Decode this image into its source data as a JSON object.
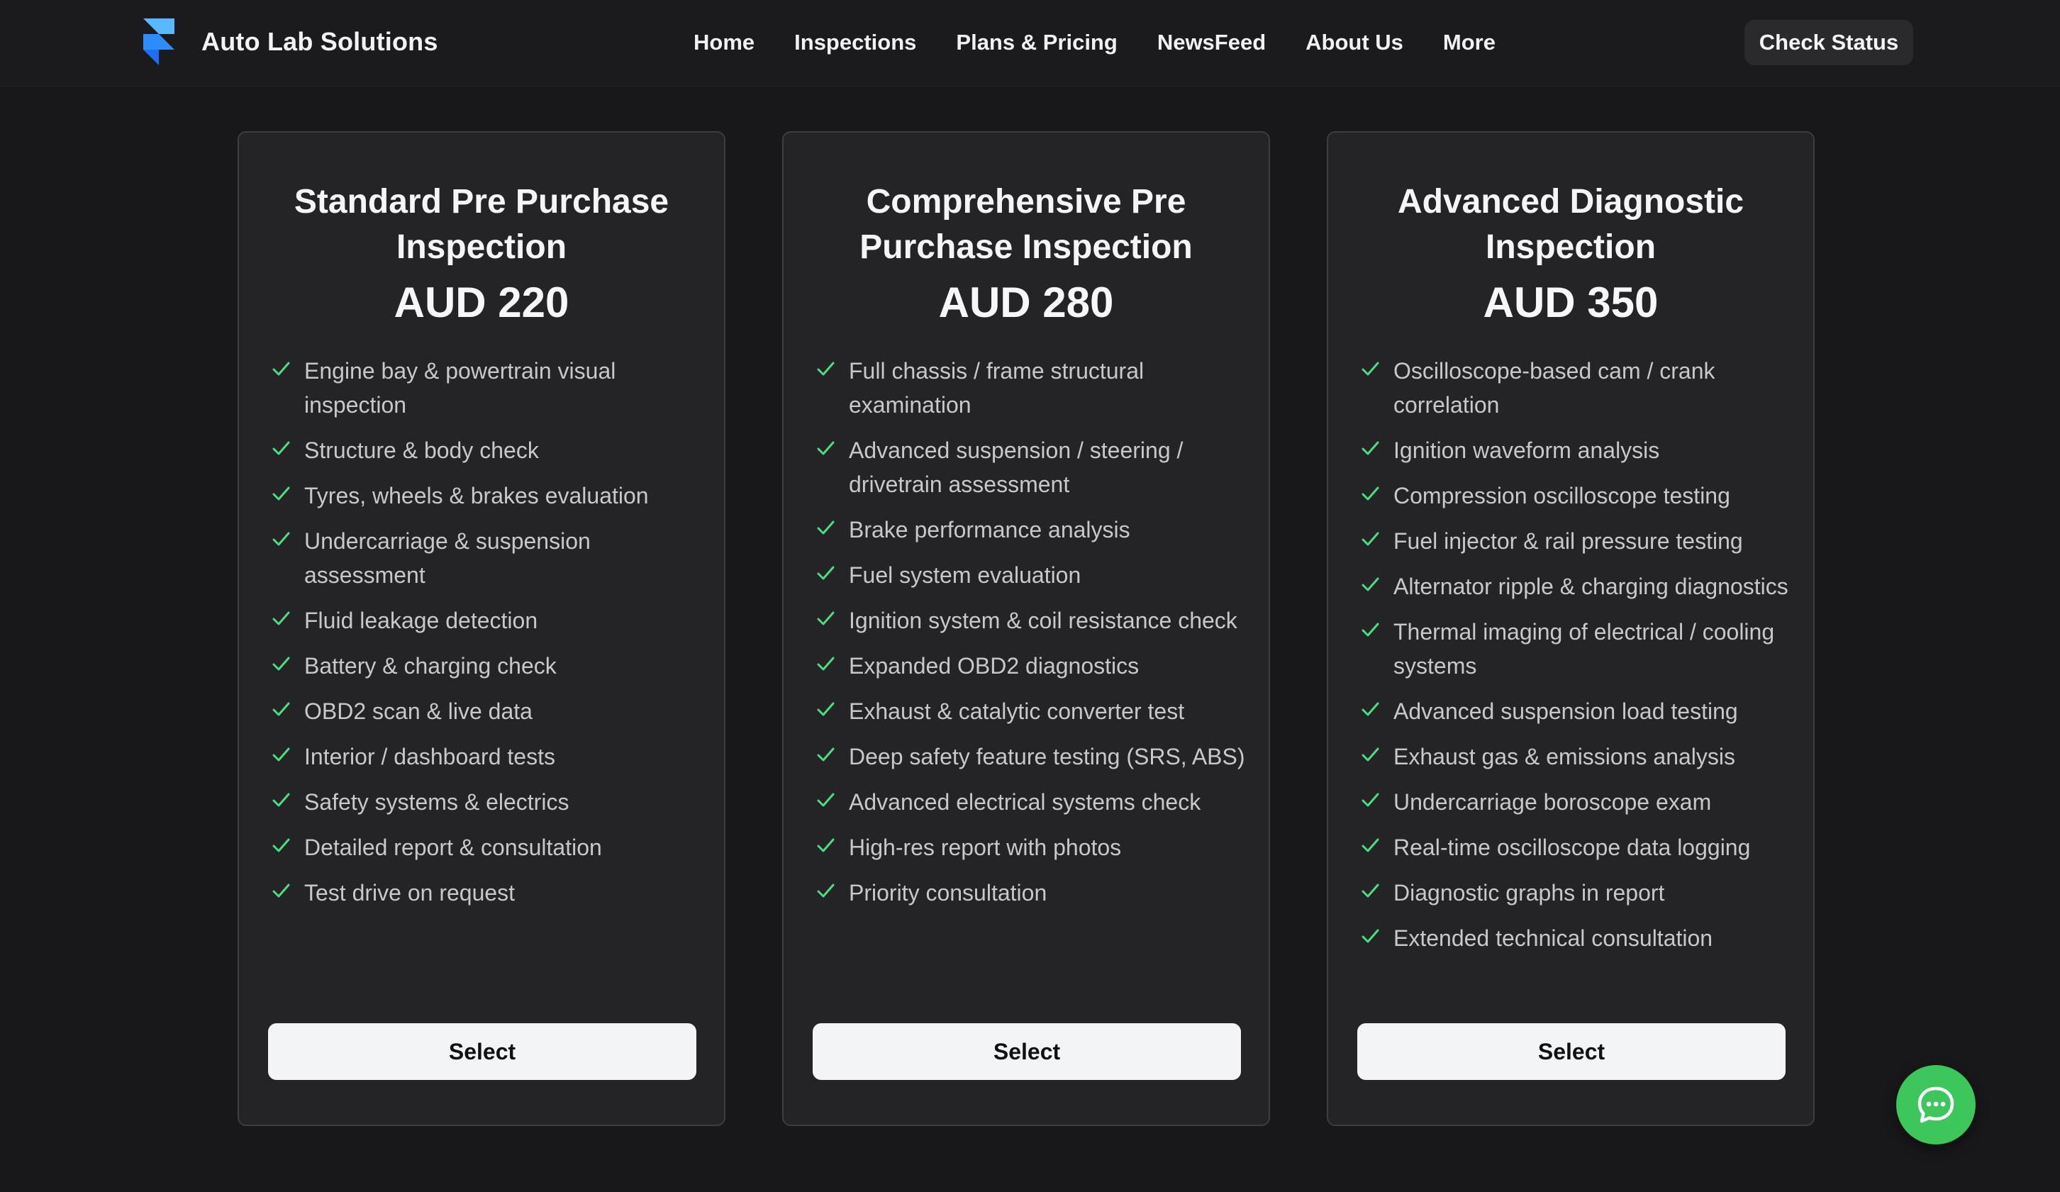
{
  "header": {
    "brand": "Auto Lab Solutions",
    "nav": [
      "Home",
      "Inspections",
      "Plans & Pricing",
      "NewsFeed",
      "About Us",
      "More"
    ],
    "check_status": "Check Status"
  },
  "plans": [
    {
      "title": "Standard Pre Purchase Inspection",
      "price": "AUD 220",
      "features": [
        "Engine bay & powertrain visual inspection",
        "Structure & body check",
        "Tyres, wheels & brakes evaluation",
        "Undercarriage & suspension assessment",
        "Fluid leakage detection",
        "Battery & charging check",
        "OBD2 scan & live data",
        "Interior / dashboard tests",
        "Safety systems & electrics",
        "Detailed report & consultation",
        "Test drive on request"
      ],
      "button": "Select"
    },
    {
      "title": "Comprehensive Pre Purchase Inspection",
      "price": "AUD 280",
      "features": [
        "Full chassis / frame structural examination",
        "Advanced suspension / steering / drivetrain assessment",
        "Brake performance analysis",
        "Fuel system evaluation",
        "Ignition system & coil resistance check",
        "Expanded OBD2 diagnostics",
        "Exhaust & catalytic converter test",
        "Deep safety feature testing (SRS, ABS)",
        "Advanced electrical systems check",
        "High-res report with photos",
        "Priority consultation"
      ],
      "button": "Select"
    },
    {
      "title": "Advanced Diagnostic Inspection",
      "price": "AUD 350",
      "features": [
        "Oscilloscope-based cam / crank correlation",
        "Ignition waveform analysis",
        "Compression oscilloscope testing",
        "Fuel injector & rail pressure testing",
        "Alternator ripple & charging diagnostics",
        "Thermal imaging of electrical / cooling systems",
        "Advanced suspension load testing",
        "Exhaust gas & emissions analysis",
        "Undercarriage boroscope exam",
        "Real-time oscilloscope data logging",
        "Diagnostic graphs in report",
        "Extended technical consultation"
      ],
      "button": "Select"
    }
  ],
  "icons": {
    "feature": "check-icon",
    "chat": "chat-bubble-icon",
    "logo": "framer-logo-icon"
  },
  "colors": {
    "check": "#4ade80",
    "chat_button": "#3cc65c",
    "logo_light": "#5ab8ff",
    "logo_dark": "#1e6ff0"
  }
}
